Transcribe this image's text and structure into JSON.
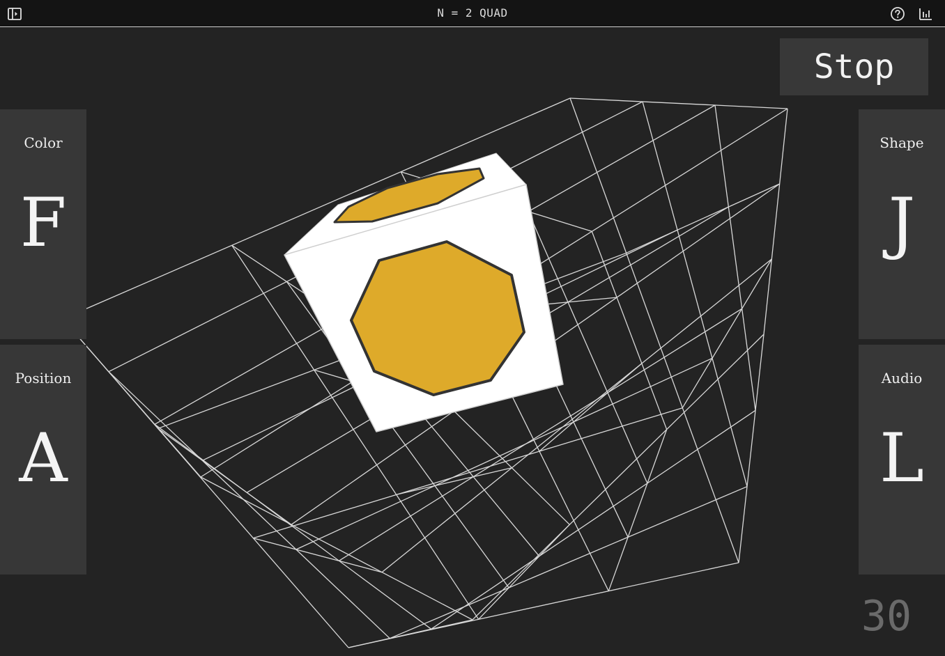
{
  "header": {
    "title": "N = 2  QUAD",
    "sidebar_toggle_icon": "sidebar-toggle-icon",
    "help_icon": "question-circle-icon",
    "stats_icon": "bar-chart-icon"
  },
  "controls": {
    "stop_label": "Stop"
  },
  "panels": {
    "color": {
      "label": "Color",
      "key": "F"
    },
    "position": {
      "label": "Position",
      "key": "A"
    },
    "shape": {
      "label": "Shape",
      "key": "J"
    },
    "audio": {
      "label": "Audio",
      "key": "L"
    }
  },
  "trials_remaining": "30",
  "stimulus": {
    "grid": "3x3x3 wireframe cube",
    "shape": "octagon",
    "shape_color": "#DEAA2A",
    "block_color": "#FFFFFF"
  },
  "colors": {
    "background": "#232323",
    "panel": "#373737",
    "topbar": "#141414",
    "wire": "#D8D8D8"
  }
}
